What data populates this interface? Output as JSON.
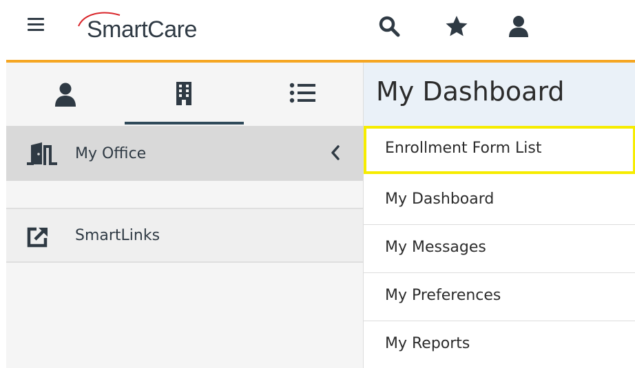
{
  "app": {
    "name": "SmartCare"
  },
  "colors": {
    "accent_rule": "#f5a623",
    "icon_dark": "#2f3a44",
    "logo_swoosh": "#d9252a",
    "highlight_border": "#f6ec00",
    "header_bg": "#eaf1f8"
  },
  "topbar": {
    "icons": [
      "hamburger-menu-icon",
      "search-icon",
      "star-icon",
      "user-icon"
    ]
  },
  "left_panel": {
    "tabs": [
      "person-icon",
      "building-icon",
      "list-icon"
    ],
    "active_tab_index": 1,
    "items": [
      {
        "label": "My Office",
        "icon": "door-icon",
        "chevron": "chevron-left-icon"
      },
      {
        "label": "SmartLinks",
        "icon": "external-link-icon"
      }
    ]
  },
  "right_panel": {
    "title": "My Dashboard",
    "menu": [
      {
        "label": "Enrollment Form List",
        "highlighted": true
      },
      {
        "label": "My Dashboard"
      },
      {
        "label": "My Messages"
      },
      {
        "label": "My Preferences"
      },
      {
        "label": "My Reports"
      }
    ]
  }
}
